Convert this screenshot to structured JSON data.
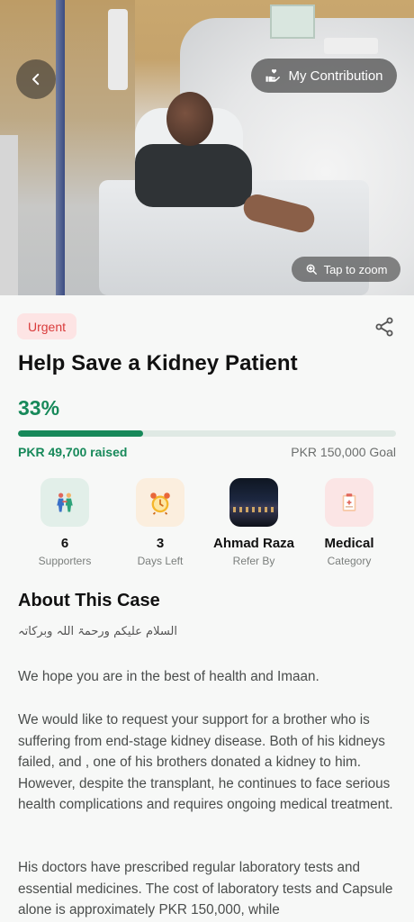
{
  "hero": {
    "back_icon": "chevron-left-icon",
    "contribution_label": "My Contribution",
    "contribution_icon": "hand-heart-icon",
    "zoom_label": "Tap to zoom",
    "zoom_icon": "magnifier-icon"
  },
  "campaign": {
    "badge": "Urgent",
    "title": "Help Save a Kidney Patient",
    "percent_text": "33%",
    "progress": 0.33,
    "raised": "PKR 49,700 raised",
    "goal": "PKR 150,000 Goal"
  },
  "stats": [
    {
      "value": "6",
      "label": "Supporters",
      "icon": "supporters-icon"
    },
    {
      "value": "3",
      "label": "Days Left",
      "icon": "alarm-clock-icon"
    },
    {
      "value": "Ahmad Raza",
      "label": "Refer By",
      "icon": "referrer-photo"
    },
    {
      "value": "Medical",
      "label": "Category",
      "icon": "clipboard-icon"
    }
  ],
  "about": {
    "heading": "About This Case",
    "greeting": "السلام علیکم ورحمۃ اللہ وبرکاتہ",
    "p1": "We hope you are in the best of health and Imaan.",
    "p2": "We would like to request your support for a brother who is suffering from end-stage kidney disease. Both of his kidneys failed, and , one of his brothers donated a kidney to him. However, despite the transplant, he continues to face serious health complications and requires ongoing medical treatment.",
    "p3": "His doctors have prescribed regular laboratory tests and essential medicines. The cost of laboratory tests and Capsule alone is approximately PKR 150,000, while"
  },
  "colors": {
    "accent": "#17895a",
    "urgent_bg": "#fde4e4",
    "urgent_text": "#d93b3b"
  }
}
